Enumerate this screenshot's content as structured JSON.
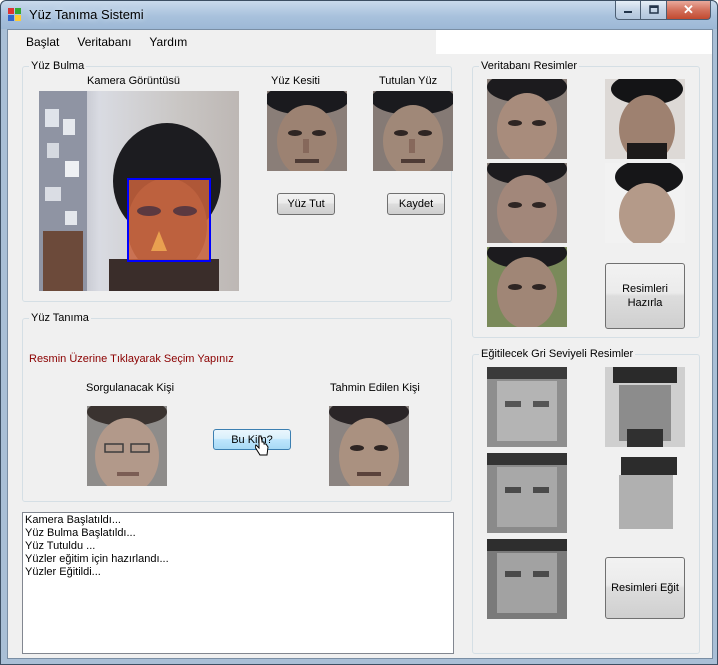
{
  "window": {
    "title": "Yüz Tanıma Sistemi",
    "close_glyph": "✕"
  },
  "menu": [
    "Başlat",
    "Veritabanı",
    "Yardım"
  ],
  "face_detection": {
    "title": "Yüz Bulma",
    "camera_label": "Kamera Görüntüsü",
    "face_slice_label": "Yüz Kesiti",
    "held_face_label": "Tutulan Yüz",
    "grab_button": "Yüz Tut",
    "save_button": "Kaydet"
  },
  "face_recognition": {
    "title": "Yüz Tanıma",
    "hint": "Resmin Üzerine Tıklayarak Seçim Yapınız",
    "query_label": "Sorgulanacak Kişi",
    "predicted_label": "Tahmin Edilen Kişi",
    "who_button": "Bu Kim?"
  },
  "database": {
    "title": "Veritabanı Resimler",
    "prepare_button_line1": "Resimleri",
    "prepare_button_line2": "Hazırla"
  },
  "training": {
    "title": "Eğitilecek Gri Seviyeli Resimler",
    "train_button": "Resimleri Eğit"
  },
  "log": [
    "Kamera Başlatıldı...",
    "Yüz Bulma Başlatıldı...",
    "Yüz Tutuldu ...",
    "Yüzler eğitim için hazırlandı...",
    "Yüzler Eğitildi..."
  ],
  "icons": {
    "app": "app-icon",
    "minimize": "minimize-icon",
    "maximize": "maximize-icon",
    "close": "close-icon",
    "cursor": "mouse-cursor-icon"
  },
  "colors": {
    "face_box": "#0000ff",
    "hint_text": "#8b0000",
    "client_bg": "#f0f0f0"
  }
}
